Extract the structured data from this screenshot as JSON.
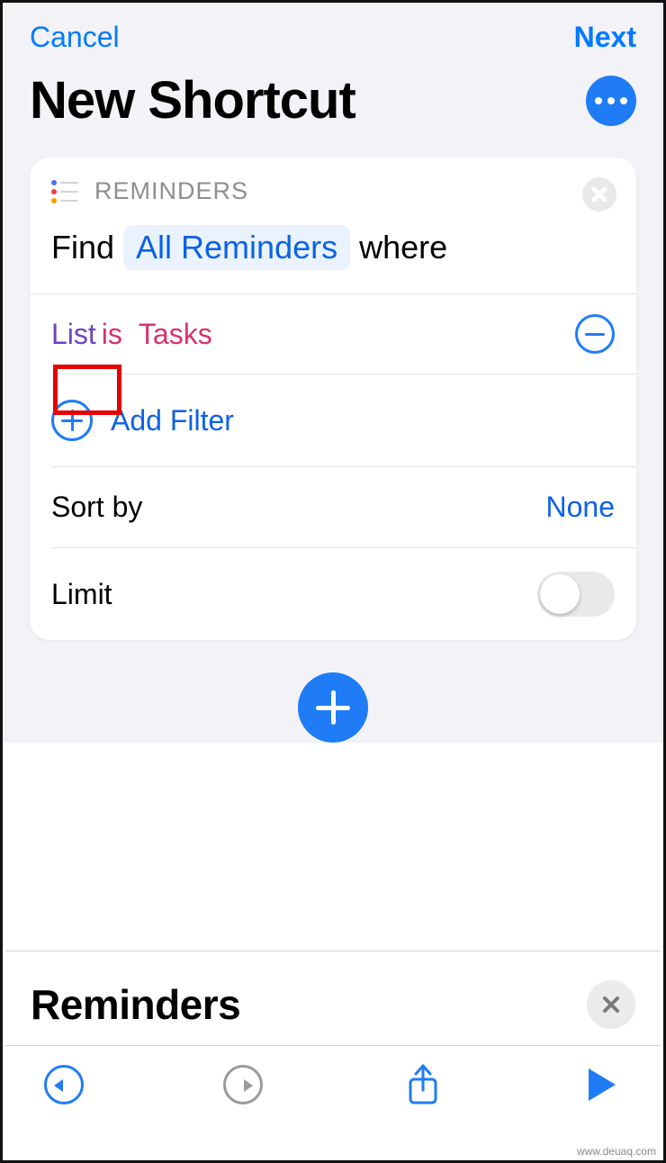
{
  "nav": {
    "cancel": "Cancel",
    "next": "Next"
  },
  "page": {
    "title": "New Shortcut"
  },
  "action_card": {
    "app": "REMINDERS",
    "query": {
      "find": "Find",
      "scope": "All Reminders",
      "where": "where"
    },
    "filter": {
      "field": "List",
      "operator": "is",
      "value": "Tasks"
    },
    "add_filter_label": "Add Filter",
    "sort_by": {
      "label": "Sort by",
      "value": "None"
    },
    "limit": {
      "label": "Limit",
      "on": false
    }
  },
  "sheet": {
    "title": "Reminders"
  },
  "watermark": "www.deuaq.com"
}
